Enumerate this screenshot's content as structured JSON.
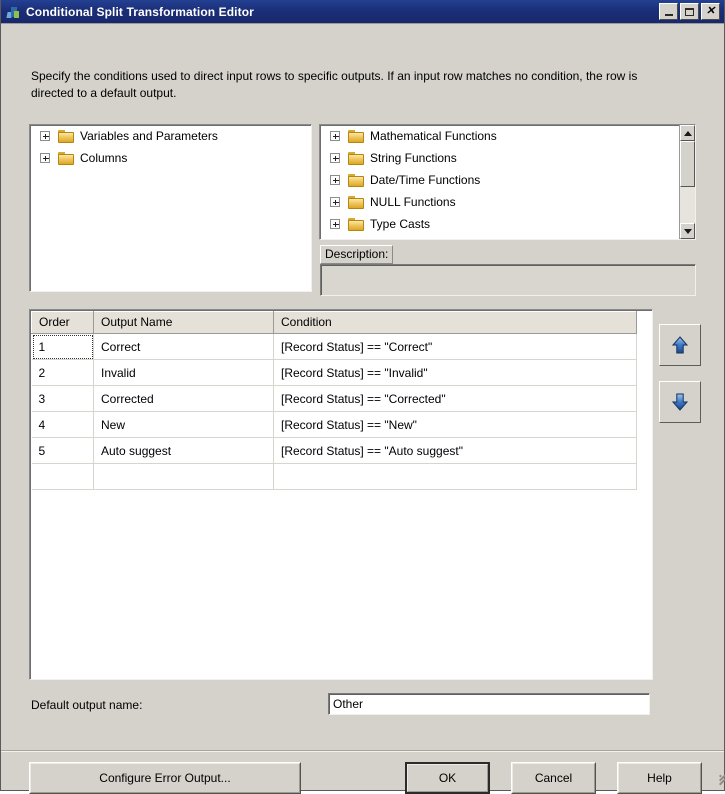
{
  "window": {
    "title": "Conditional Split Transformation Editor",
    "icon": "split-transform-icon",
    "controls": [
      {
        "name": "minimize-button",
        "glyph": "minimize-icon",
        "label": "_"
      },
      {
        "name": "maximize-button",
        "glyph": "maximize-icon",
        "label": "□"
      },
      {
        "name": "close-button",
        "glyph": "close-icon",
        "label": "X"
      }
    ]
  },
  "instructions": "Specify the conditions used to direct input rows to specific outputs. If an input row matches no condition, the row is directed to a default output.",
  "left_tree": {
    "items": [
      {
        "label": "Variables and Parameters",
        "icon": "folder-icon",
        "expander": "plus-icon"
      },
      {
        "label": "Columns",
        "icon": "folder-icon",
        "expander": "plus-icon"
      }
    ]
  },
  "right_tree": {
    "items": [
      {
        "label": "Mathematical Functions",
        "icon": "folder-icon",
        "expander": "plus-icon"
      },
      {
        "label": "String Functions",
        "icon": "folder-icon",
        "expander": "plus-icon"
      },
      {
        "label": "Date/Time Functions",
        "icon": "folder-icon",
        "expander": "plus-icon"
      },
      {
        "label": "NULL Functions",
        "icon": "folder-icon",
        "expander": "plus-icon"
      },
      {
        "label": "Type Casts",
        "icon": "folder-icon",
        "expander": "plus-icon"
      }
    ],
    "scrollbar": {
      "up_icon": "scroll-up-icon",
      "down_icon": "scroll-down-icon"
    }
  },
  "description": {
    "label": "Description:",
    "value": ""
  },
  "grid": {
    "columns": [
      "Order",
      "Output Name",
      "Condition"
    ],
    "rows": [
      {
        "order": "1",
        "output_name": "Correct",
        "condition": "[Record Status] == \"Correct\"",
        "selected": true
      },
      {
        "order": "2",
        "output_name": "Invalid",
        "condition": "[Record Status] == \"Invalid\"",
        "selected": false
      },
      {
        "order": "3",
        "output_name": "Corrected",
        "condition": "[Record Status] == \"Corrected\"",
        "selected": false
      },
      {
        "order": "4",
        "output_name": "New",
        "condition": "[Record Status] == \"New\"",
        "selected": false
      },
      {
        "order": "5",
        "output_name": "Auto suggest",
        "condition": "[Record Status] == \"Auto suggest\"",
        "selected": false
      },
      {
        "order": "",
        "output_name": "",
        "condition": "",
        "selected": false
      }
    ]
  },
  "move_buttons": {
    "up": {
      "name": "move-up-button",
      "icon": "arrow-up-icon"
    },
    "down": {
      "name": "move-down-button",
      "icon": "arrow-down-icon"
    }
  },
  "default_output": {
    "label": "Default output name:",
    "value": "Other",
    "placeholder": ""
  },
  "footer": {
    "configure_error_output": "Configure Error Output...",
    "ok": "OK",
    "cancel": "Cancel",
    "help": "Help"
  },
  "colors": {
    "titlebar": "#1b2e78",
    "dialog_background": "#d5d2cb",
    "grid_header": "#e5e0d8",
    "field_background": "#ffffff",
    "folder_icon": "#f0c860",
    "arrow_button": "#2f6ca8"
  }
}
